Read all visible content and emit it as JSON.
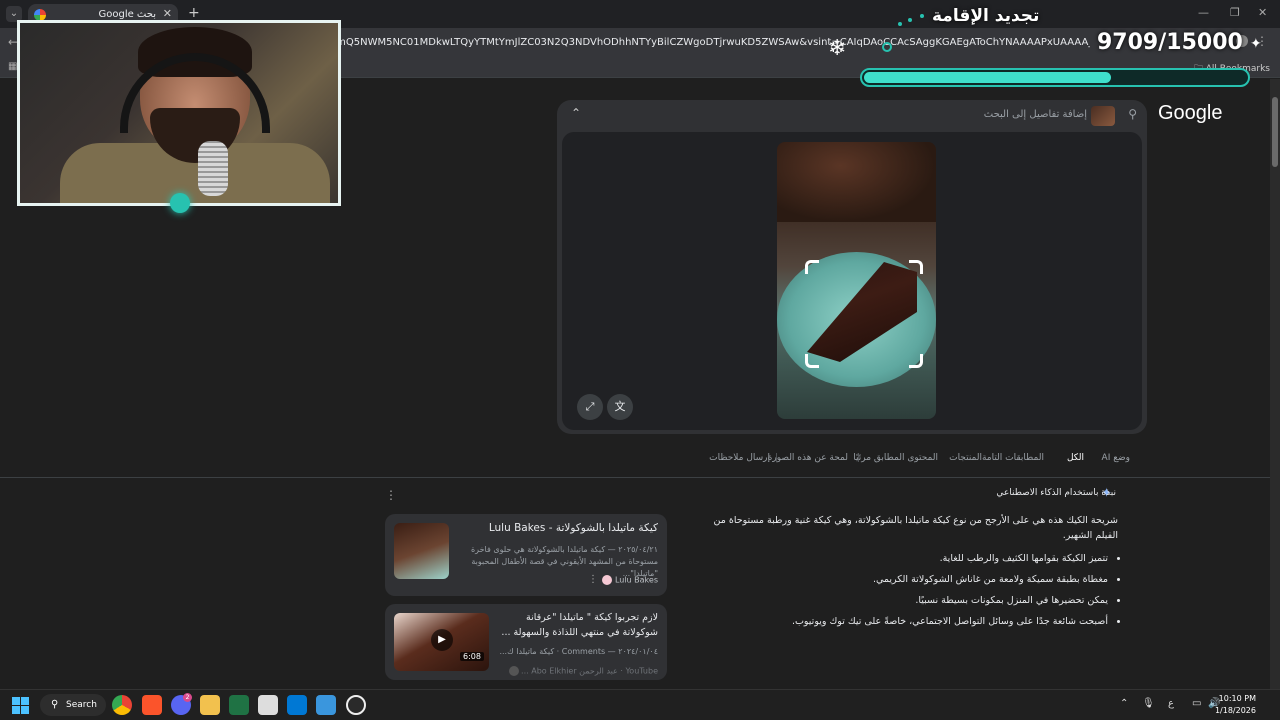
{
  "browser": {
    "tab_title": "بحث Google",
    "tab_close": "✕",
    "new_tab": "+",
    "url": "YmQ5NWM5NC01MDkwLTQyYTMtYmJlZC03N2Q3NDVhODhhNTYyBilCZWgoDTjrwuKD5ZWSAw&vsint=CAIqDAoCCAcSAggKGAEgAToChYNAAAAPxUAAAA_HQAAgD8IAACAPzABEMg",
    "all_bookmarks": "All Bookmarks"
  },
  "lens": {
    "logo": "Google",
    "placeholder": "إضافة تفاصيل إلى البحث",
    "tabs": [
      {
        "label": "وضع AI"
      },
      {
        "label": "الكل"
      },
      {
        "label": "المطابقات التامة"
      },
      {
        "label": "المنتجات"
      },
      {
        "label": "المحتوى المطابق مرئيًا"
      },
      {
        "label": "لمحة عن هذه الصورة"
      },
      {
        "label": "إرسال ملاحظات"
      }
    ]
  },
  "ai_overview": {
    "header": "نبذة باستخدام الذكاء الاصطناعي",
    "intro": "شريحة الكيك هذه هي على الأرجح من نوع كيكة ماتيلدا بالشوكولاتة، وهي كيكة غنية ورطبة مستوحاة من الفيلم الشهير.",
    "bullets": [
      "تتميز الكيكة بقوامها الكثيف والرطب للغاية.",
      "مغطاة بطبقة سميكة ولامعة من غاناش الشوكولاتة الكريمي.",
      "يمكن تحضيرها في المنزل بمكونات بسيطة نسبيًا.",
      "أصبحت شائعة جدًا على وسائل التواصل الاجتماعي، خاصةً على تيك توك ويوتيوب."
    ]
  },
  "cards": [
    {
      "title": "كيكة ماتيلدا بالشوكولاتة - Lulu Bakes",
      "snippet": "٢٠٢٥/٠٤/٢١ — كيكة ماتيلدا بالشوكولاتة هي حلوى فاخرة مستوحاة من المشهد الأيقوني في قصة الأطفال المحبوبة \"ماتيلدا\"...",
      "source": "Lulu Bakes"
    },
    {
      "title": "لازم تجربوا كيكة \" ماتيلدا \"عرقانة شوكولاتة في منتهي اللذاذة والسهولة ...",
      "snippet": "٢٠٢٤/٠١/٠٤ — Comments · كيكة ماتيلدا ك...",
      "source": "YouTube · عبد الرحمن Abo Elkhier ...",
      "duration": "6:08"
    }
  ],
  "overlay": {
    "goal_title": "تجديد الإقامة",
    "goal_count": "9709/15000",
    "progress": 0.647
  },
  "taskbar": {
    "search": "Search",
    "time": "10:10 PM",
    "date": "1/18/2026",
    "lang": "ع",
    "badges": {
      "brave": "",
      "discord": "2"
    }
  }
}
